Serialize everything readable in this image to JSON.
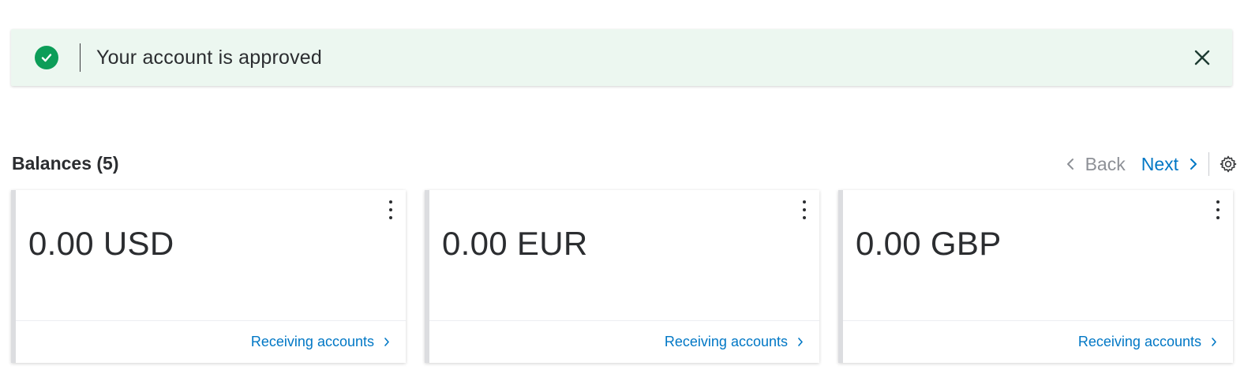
{
  "banner": {
    "message": "Your account is approved",
    "status_color": "#0c9d58",
    "icon": "check-circle-icon",
    "close_icon": "close-icon"
  },
  "balances": {
    "title": "Balances (5)",
    "pager": {
      "back_label": "Back",
      "next_label": "Next"
    },
    "settings_icon": "gear-icon",
    "cards": [
      {
        "amount": "0.00 USD",
        "link_label": "Receiving accounts"
      },
      {
        "amount": "0.00 EUR",
        "link_label": "Receiving accounts"
      },
      {
        "amount": "0.00 GBP",
        "link_label": "Receiving accounts"
      }
    ]
  },
  "colors": {
    "link": "#0077c5",
    "muted": "#8d9096",
    "banner_bg": "#ecf7f0"
  }
}
